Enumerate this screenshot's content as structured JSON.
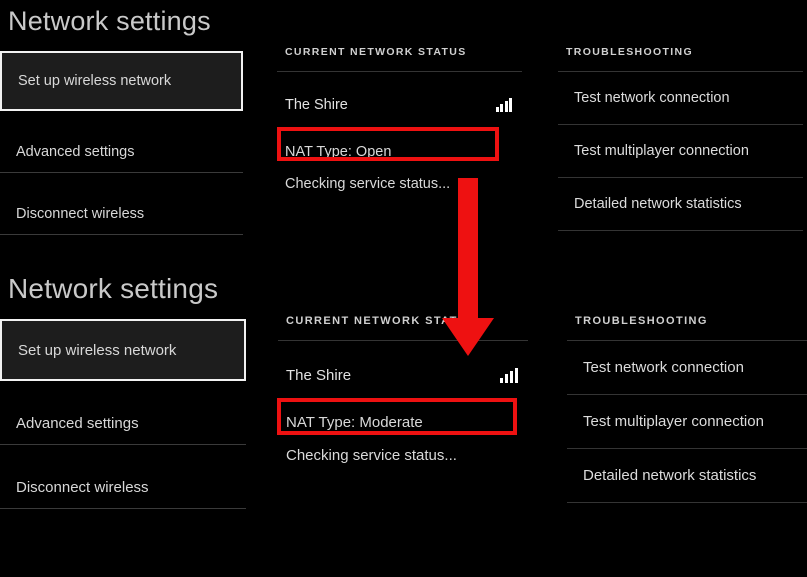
{
  "meta": {
    "accent_red": "#ee1111",
    "background": "#000000",
    "text_color": "#d8d8d8",
    "selected_fill": "#1d1d1d",
    "selected_border": "#f2f2f2"
  },
  "panels": [
    {
      "id": "top",
      "page_title": "Network settings",
      "nav": {
        "items": [
          {
            "label": "Set up wireless network",
            "selected": true
          },
          {
            "label": "Advanced settings",
            "selected": false
          },
          {
            "label": "Disconnect wireless",
            "selected": false
          }
        ]
      },
      "status": {
        "header": "CURRENT NETWORK STATUS",
        "network_name": "The Shire",
        "signal_icon": "signal-bars-icon",
        "signal_bars": 4,
        "nat_type": "NAT Type: Open",
        "service_status": "Checking service status..."
      },
      "troubleshooting": {
        "header": "TROUBLESHOOTING",
        "items": [
          "Test network connection",
          "Test multiplayer connection",
          "Detailed network statistics"
        ]
      }
    },
    {
      "id": "bottom",
      "page_title": "Network settings",
      "nav": {
        "items": [
          {
            "label": "Set up wireless network",
            "selected": true
          },
          {
            "label": "Advanced settings",
            "selected": false
          },
          {
            "label": "Disconnect wireless",
            "selected": false
          }
        ]
      },
      "status": {
        "header": "CURRENT NETWORK STATUS",
        "network_name": "The Shire",
        "signal_icon": "signal-bars-icon",
        "signal_bars": 4,
        "nat_type": "NAT Type: Moderate",
        "service_status": "Checking service status..."
      },
      "troubleshooting": {
        "header": "TROUBLESHOOTING",
        "items": [
          "Test network connection",
          "Test multiplayer connection",
          "Detailed network statistics"
        ]
      }
    }
  ],
  "annotations": {
    "arrow": {
      "icon": "down-arrow-icon",
      "color": "#ee1111"
    },
    "highlight_boxes": [
      {
        "target": "NAT Type: Open",
        "color": "#ee1111"
      },
      {
        "target": "NAT Type: Moderate",
        "color": "#ee1111"
      }
    ]
  }
}
